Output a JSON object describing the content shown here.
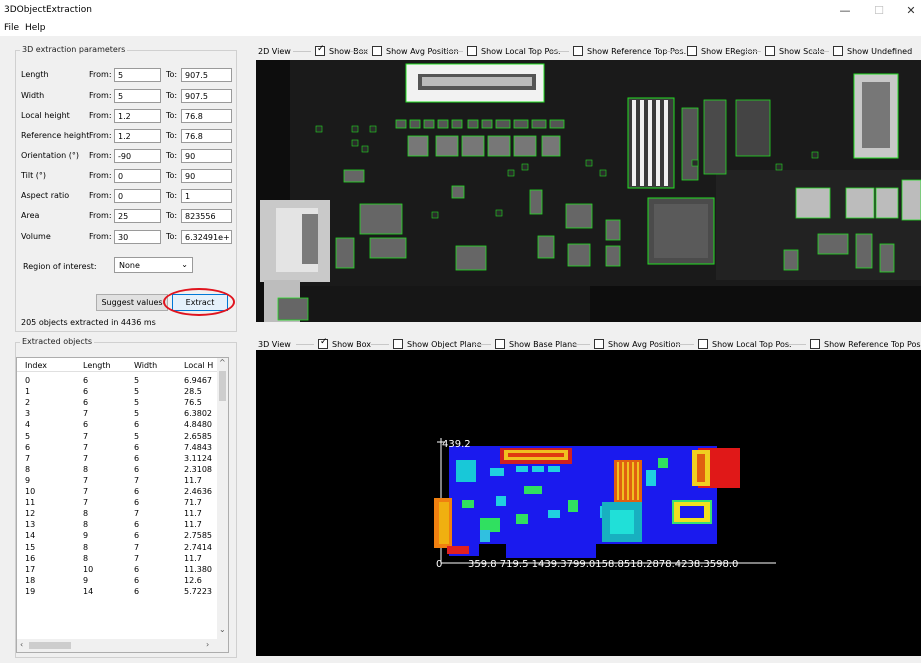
{
  "window": {
    "title": "3DObjectExtraction",
    "minimize": "—",
    "maximize": "☐",
    "close": "✕"
  },
  "menu": [
    "File",
    "Help"
  ],
  "params": {
    "title": "3D extraction parameters",
    "from_label": "From:",
    "to_label": "To:",
    "rows": [
      {
        "name": "Length",
        "from": "5",
        "to": "907.5"
      },
      {
        "name": "Width",
        "from": "5",
        "to": "907.5"
      },
      {
        "name": "Local height",
        "from": "1.2",
        "to": "76.8"
      },
      {
        "name": "Reference height",
        "from": "1.2",
        "to": "76.8"
      },
      {
        "name": "Orientation (°)",
        "from": "-90",
        "to": "90"
      },
      {
        "name": "Tilt (°)",
        "from": "0",
        "to": "90"
      },
      {
        "name": "Aspect ratio",
        "from": "0",
        "to": "1"
      },
      {
        "name": "Area",
        "from": "25",
        "to": "823556"
      },
      {
        "name": "Volume",
        "from": "30",
        "to": "6.32491e+"
      }
    ],
    "roi_label": "Region of interest:",
    "roi_value": "None",
    "suggest_label": "Suggest values",
    "extract_label": "Extract",
    "status": "205 objects extracted in 4436 ms"
  },
  "objects": {
    "title": "Extracted objects",
    "columns": [
      "Index",
      "Length",
      "Width",
      "Local H"
    ],
    "rows": [
      [
        "0",
        "6",
        "5",
        "6.9467"
      ],
      [
        "1",
        "6",
        "5",
        "28.5"
      ],
      [
        "2",
        "6",
        "5",
        "76.5"
      ],
      [
        "3",
        "7",
        "5",
        "6.3802"
      ],
      [
        "4",
        "6",
        "6",
        "4.8480"
      ],
      [
        "5",
        "7",
        "5",
        "2.6585"
      ],
      [
        "6",
        "7",
        "6",
        "7.4843"
      ],
      [
        "7",
        "7",
        "6",
        "3.1124"
      ],
      [
        "8",
        "8",
        "6",
        "2.3108"
      ],
      [
        "9",
        "7",
        "7",
        "11.7"
      ],
      [
        "10",
        "7",
        "6",
        "2.4636"
      ],
      [
        "11",
        "7",
        "6",
        "71.7"
      ],
      [
        "12",
        "8",
        "7",
        "11.7"
      ],
      [
        "13",
        "8",
        "6",
        "11.7"
      ],
      [
        "14",
        "9",
        "6",
        "2.7585"
      ],
      [
        "15",
        "8",
        "7",
        "2.7414"
      ],
      [
        "16",
        "8",
        "7",
        "11.7"
      ],
      [
        "17",
        "10",
        "6",
        "11.380"
      ],
      [
        "18",
        "9",
        "6",
        "12.6"
      ],
      [
        "19",
        "14",
        "6",
        "5.7223"
      ]
    ]
  },
  "view2d": {
    "label": "2D View",
    "options": [
      {
        "label": "Show Box",
        "checked": true
      },
      {
        "label": "Show Avg Position",
        "checked": false
      },
      {
        "label": "Show Local Top Pos.",
        "checked": false
      },
      {
        "label": "Show Reference Top Pos.",
        "checked": false
      },
      {
        "label": "Show ERegion",
        "checked": false
      },
      {
        "label": "Show Scale",
        "checked": false
      },
      {
        "label": "Show Undefined",
        "checked": false
      }
    ]
  },
  "view3d": {
    "label": "3D View",
    "options": [
      {
        "label": "Show Box",
        "checked": true
      },
      {
        "label": "Show Object Plane",
        "checked": false
      },
      {
        "label": "Show Base Plane",
        "checked": false
      },
      {
        "label": "Show Avg Position",
        "checked": false
      },
      {
        "label": "Show Local Top Pos.",
        "checked": false
      },
      {
        "label": "Show Reference Top Pos.",
        "checked": false
      }
    ],
    "axis_top": "439.2",
    "axis_origin": "0",
    "axis_x_ticks": "359.8 719.5   1439.3799.0158.8518.2878.4238.3598.0"
  },
  "colors": {
    "box_outline": "#22dd22",
    "highlight_ring": "#e0141e",
    "accent": "#0078d7"
  }
}
